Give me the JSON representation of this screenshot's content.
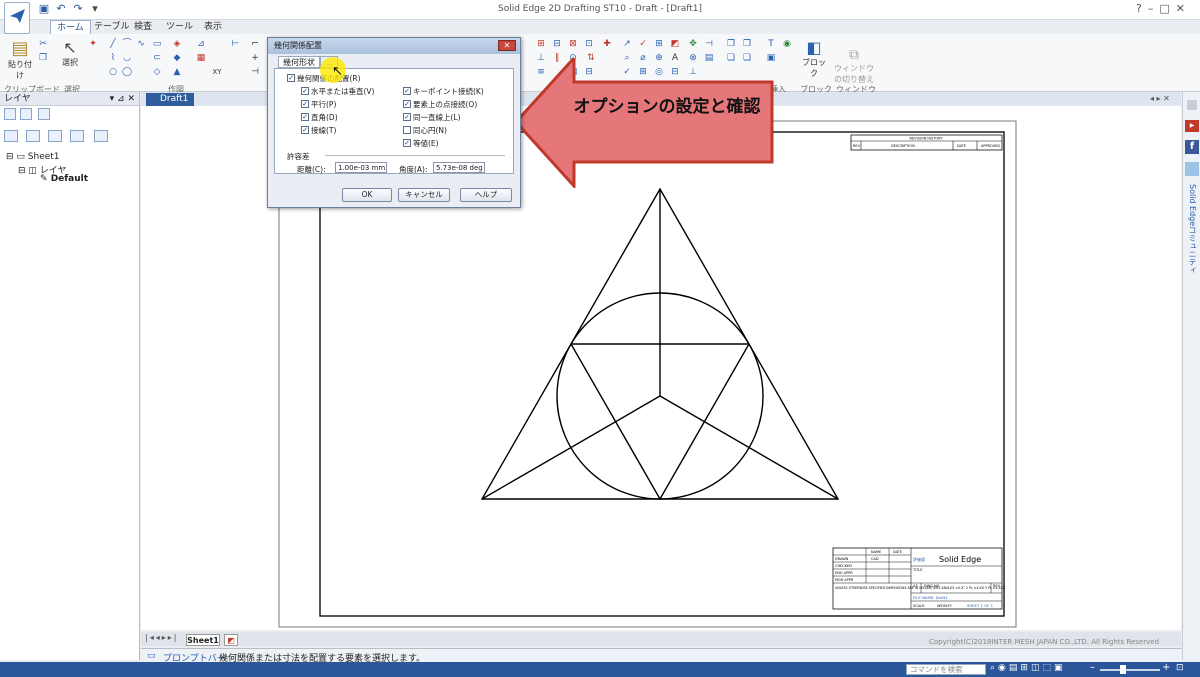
{
  "window": {
    "title": "Solid Edge 2D Drafting ST10 - Draft - [Draft1]"
  },
  "ribbon": {
    "tabs": [
      "ホーム",
      "テーブル",
      "検査",
      "ツール",
      "表示"
    ],
    "active_tab": "ホーム",
    "groups": {
      "clipboard": "クリップボード",
      "select": "選択",
      "draw": "作図",
      "block": "ブロック",
      "window": "ウィンドウ"
    },
    "buttons": {
      "paste": "貼り付け",
      "select": "選択",
      "block": "ブロック",
      "window_switch": "ウィンドウ\nの切り替え",
      "insert_fragment": "挿入"
    }
  },
  "left_pane": {
    "title": "レイヤ",
    "tree": {
      "sheet": "Sheet1",
      "layer": "レイヤ",
      "default": "Default"
    }
  },
  "document_tab": "Draft1",
  "sheet_tab": "Sheet1",
  "prompt": {
    "label": "プロンプトバー",
    "text": "幾何関係または寸法を配置する要素を選択します。"
  },
  "status": {
    "search_placeholder": "コマンドを検索",
    "copyright": "Copyright(C)2018INTER MESH JAPAN CO.,LTD. All Rights Reserved"
  },
  "right_strip": {
    "label": "Solid Edgeコミュニティ"
  },
  "dialog": {
    "title": "幾何関係配置",
    "tabs": [
      "幾何形状",
      "..."
    ],
    "checkboxes_left": [
      {
        "label": "幾何関係の配置(R)",
        "checked": true
      },
      {
        "label": "水平または垂直(V)",
        "checked": true
      },
      {
        "label": "平行(P)",
        "checked": true
      },
      {
        "label": "直角(D)",
        "checked": true
      },
      {
        "label": "接線(T)",
        "checked": true
      }
    ],
    "checkboxes_right": [
      {
        "label": "キーポイント接続(K)",
        "checked": true
      },
      {
        "label": "要素上の点接続(O)",
        "checked": true
      },
      {
        "label": "同一直線上(L)",
        "checked": true
      },
      {
        "label": "同心円(N)",
        "checked": false
      },
      {
        "label": "等値(E)",
        "checked": true
      }
    ],
    "tolerance_label": "許容差",
    "distance_label": "距離(C):",
    "distance_value": "1.00e-03 mm",
    "angle_label": "角度(A):",
    "angle_value": "5.73e-08 deg",
    "ok": "OK",
    "cancel": "キャンセル",
    "help": "ヘルプ"
  },
  "callout": {
    "text": "オプションの設定と確認",
    "color": "#e5777a"
  },
  "title_block": {
    "revision": "REVISION HISTORY",
    "rev_cols": [
      "REV",
      "DESCRIPTION",
      "DATE",
      "APPROVED"
    ],
    "rows": [
      "DRAWN",
      "CHECKED",
      "ENG APPR",
      "MGR APPR"
    ],
    "name_col": "NAME",
    "date_col": "DATE",
    "drawn_name": "CAD",
    "brand": "Solid Edge",
    "brand_prefix": "評価版",
    "title_lbl": "TITLE",
    "tolerances": "UNLESS OTHERWISE SPECIFIED\nDIMENSIONS ARE IN MILLIMETERS\nANGLES ±X.X°\n2 PL ±X.XX 3 PL ±X.XXX",
    "size": "A3",
    "dwg_no_lbl": "DWG NO",
    "rev_lbl": "REV",
    "file_name": "FILE NAME: Draft1",
    "scale": "SCALE:",
    "weight": "WEIGHT:",
    "sheet": "SHEET 1 OF 1"
  }
}
